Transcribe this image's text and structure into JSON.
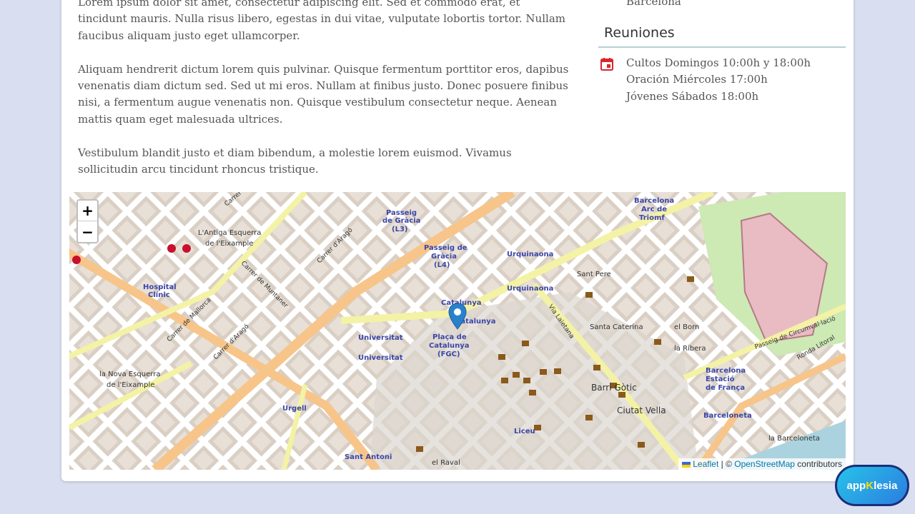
{
  "content": {
    "paragraphs": [
      "Lorem ipsum dolor sit amet, consectetur adipiscing elit. Sed et commodo erat, et tincidunt mauris. Nulla risus libero, egestas in dui vitae, vulputate lobortis tortor. Nullam faucibus aliquam justo eget ullamcorper.",
      "Aliquam hendrerit dictum lorem quis pulvinar. Quisque fermentum porttitor eros, dapibus venenatis diam dictum sed. Sed ut mi eros. Nullam at finibus justo. Donec posuere finibus nisi, a fermentum augue venenatis non. Quisque vestibulum consectetur neque. Aenean mattis quam eget malesuada ultrices.",
      "Vestibulum blandit justo et diam bibendum, a molestie lorem euismod. Vivamus sollicitudin arcu tincidunt rhoncus tristique."
    ]
  },
  "sidebar": {
    "address_tail": "Barcelona",
    "meetings_title": "Reuniones",
    "schedule": [
      "Cultos Domingos 10:00h y 18:00h",
      "Oración Miércoles 17:00h",
      "Jóvenes Sábados 18:00h"
    ]
  },
  "map": {
    "zoom_in": "+",
    "zoom_out": "−",
    "attribution": {
      "leaflet": "Leaflet",
      "sep": " | © ",
      "osm": "OpenStreetMap",
      "suffix": " contributors"
    },
    "labels": [
      "Carrer d'Aribau",
      "L'Antiga Esquerra de l'Eixample",
      "Hospital Clínic",
      "Passeig de Gràcia (L3)",
      "Passeig de Gràcia (L4)",
      "Urquinaona",
      "Catalunya",
      "Plaça de Catalunya (FGC)",
      "Universitat",
      "Urgell",
      "Sant Antoni",
      "la Nova Esquerra de l'Eixample",
      "Barri Gòtic",
      "Ciutat Vella",
      "Santa Caterina",
      "el Born",
      "la Ribera",
      "Barcelona Arc de Triomf",
      "Sant Pere",
      "Barcelona Estació de França",
      "Barceloneta",
      "la Barceloneta",
      "Liceu",
      "el Raval",
      "Carrer d'Aragó",
      "Carrer de Muntaner",
      "Carrer de Mallorca",
      "Via Laietana",
      "Ronda Litoral",
      "Passeig de Circumval·lació"
    ],
    "marker": "location-pin"
  },
  "logo": {
    "prefix": "app",
    "accent": "K",
    "suffix": "lesia"
  },
  "colors": {
    "page_bg": "#d9dff0",
    "marker": "#2a81cb",
    "calendar_icon": "#d9262e",
    "section_rule": "#b5cfd6"
  }
}
